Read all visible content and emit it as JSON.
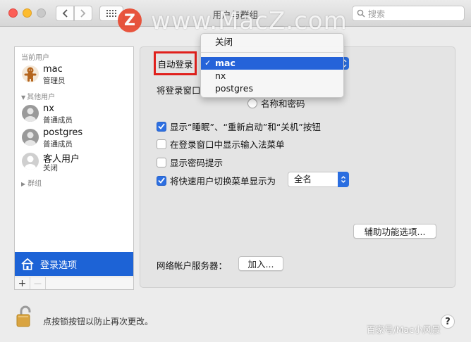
{
  "window": {
    "title": "用户与群组"
  },
  "toolbar": {
    "search_placeholder": "搜索"
  },
  "watermark": {
    "logo_letter": "Z",
    "text": "www.MacZ.com",
    "source": "百家号/Mac小风景"
  },
  "sidebar": {
    "current_header": "当前用户",
    "other_header": "其他用户",
    "groups_label": "群组",
    "current_user": {
      "name": "mac",
      "role": "管理员"
    },
    "other_users": [
      {
        "name": "nx",
        "role": "普通成员"
      },
      {
        "name": "postgres",
        "role": "普通成员"
      },
      {
        "name": "客人用户",
        "role": "关闭"
      }
    ],
    "login_options_label": "登录选项",
    "add_label": "+",
    "remove_label": "—"
  },
  "main": {
    "auto_login_label": "自动登录",
    "show_login_window_label": "将登录窗口",
    "radio_name_password": "名称和密码",
    "checkboxes": [
      {
        "label": "显示“睡眠”、“重新启动”和“关机”按钮",
        "checked": true
      },
      {
        "label": "在登录窗口中显示输入法菜单",
        "checked": false
      },
      {
        "label": "显示密码提示",
        "checked": false
      },
      {
        "label": "将快速用户切换菜单显示为",
        "checked": true
      }
    ],
    "fast_switch_value": "全名",
    "accessibility_button": "辅助功能选项...",
    "network_server_label": "网络帐户服务器：",
    "join_button": "加入..."
  },
  "auto_login_menu": {
    "items": [
      "关闭",
      "mac",
      "nx",
      "postgres"
    ],
    "selected": "mac"
  },
  "footer": {
    "lock_text": "点按锁按钮以防止再次更改。",
    "help": "?"
  },
  "colors": {
    "accent": "#2563d9",
    "highlight_box": "#e0201c"
  }
}
